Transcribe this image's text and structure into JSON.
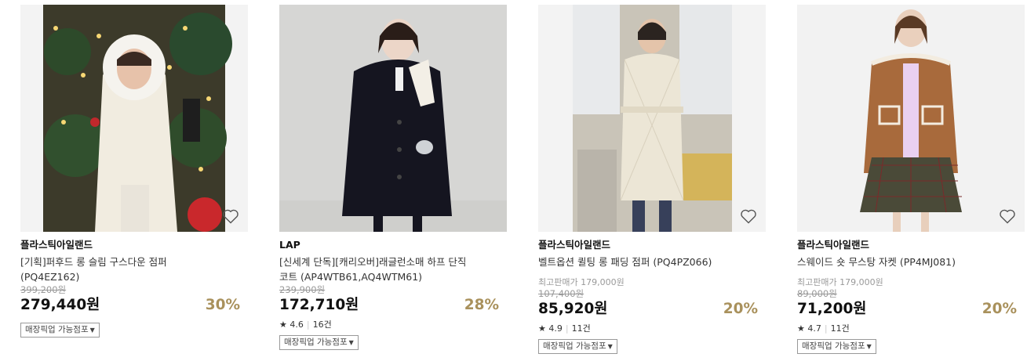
{
  "products": [
    {
      "brand": "플라스틱아일랜드",
      "name": "[기획]퍼후드 롱 슬림 구스다운 점퍼 (PQ4EZ162)",
      "best_price": "",
      "original_price": "399,200원",
      "price": "279,440원",
      "discount": "30%",
      "rating": "",
      "reviews": "",
      "pickup_label": "매장픽업 가능점포",
      "wishlist_icon": "heart-outline-icon"
    },
    {
      "brand": "LAP",
      "name": "[신세계 단독][캐리오버]래글런소매 하프 단직 코트 (AP4WTB61,AQ4WTM61)",
      "best_price": "",
      "original_price": "239,900원",
      "price": "172,710원",
      "discount": "28%",
      "rating": "4.6",
      "reviews": "16건",
      "pickup_label": "매장픽업 가능점포",
      "wishlist_icon": "heart-outline-icon"
    },
    {
      "brand": "플라스틱아일랜드",
      "name": "벨트옵션 퀼팅 롱 패딩 점퍼 (PQ4PZ066)",
      "best_price": "최고판매가 179,000원",
      "original_price": "107,400원",
      "price": "85,920원",
      "discount": "20%",
      "rating": "4.9",
      "reviews": "11건",
      "pickup_label": "매장픽업 가능점포",
      "wishlist_icon": "heart-outline-icon"
    },
    {
      "brand": "플라스틱아일랜드",
      "name": "스웨이드 숏 무스탕 자켓 (PP4MJ081)",
      "best_price": "최고판매가 179,000원",
      "original_price": "89,000원",
      "price": "71,200원",
      "discount": "20%",
      "rating": "4.7",
      "reviews": "11건",
      "pickup_label": "매장픽업 가능점포",
      "wishlist_icon": "heart-outline-icon"
    }
  ],
  "colors": {
    "discount": "#a9915c",
    "text": "#111111",
    "muted": "#999999"
  }
}
